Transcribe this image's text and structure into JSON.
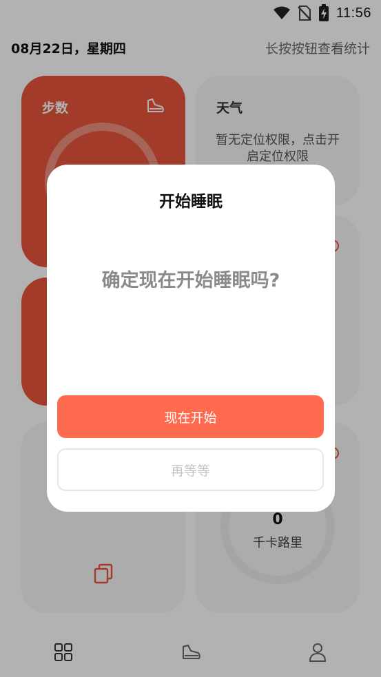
{
  "status_bar": {
    "time": "11:56",
    "icons": [
      "wifi-icon",
      "no-sim-icon",
      "battery-charging-icon"
    ]
  },
  "header": {
    "date": "08月22日，星期四",
    "hint": "长按按钮查看统计"
  },
  "cards": {
    "steps": {
      "title": "步数",
      "icon": "shoe-icon",
      "color": "#e8553d"
    },
    "weather": {
      "title": "天气",
      "message": "暂无定位权限，点击开启定位权限"
    },
    "calories": {
      "value": "0",
      "unit": "千卡路里"
    },
    "bottom_left": {
      "icon": "copy-icon"
    }
  },
  "tabbar": {
    "tabs": [
      "grid-icon",
      "shoe-icon",
      "person-icon"
    ]
  },
  "dialog": {
    "title": "开始睡眠",
    "message": "确定现在开始睡眠吗?",
    "confirm_label": "现在开始",
    "cancel_label": "再等等",
    "confirm_color": "#ff6b4f"
  }
}
